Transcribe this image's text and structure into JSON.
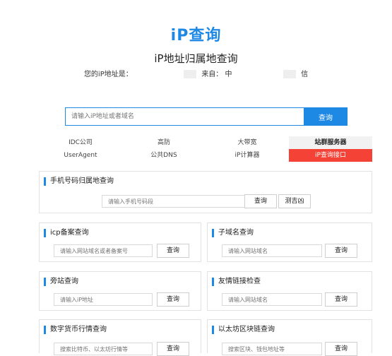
{
  "header": {
    "logo": "iP查询",
    "subtitle": "iP地址归属地查询",
    "ip_label": "您的iP地址是：",
    "from_label": "来自：",
    "from_prefix": "中",
    "from_suffix": "信"
  },
  "search": {
    "placeholder": "请输入iP地址或者域名",
    "button": "查询"
  },
  "nav": {
    "row1": [
      "IDC公司",
      "高防",
      "大带宽",
      "站群服务器"
    ],
    "row2": [
      "UserAgent",
      "公共DNS",
      "iP计算器",
      "iP查询接口"
    ]
  },
  "panels": {
    "phone": {
      "title": "手机号码归属地查询",
      "placeholder": "请输入手机号码段",
      "button": "查询",
      "button2": "测吉凶"
    },
    "icp": {
      "title": "icp备案查询",
      "placeholder": "请输入网站域名或者备案号",
      "button": "查询"
    },
    "subdomain": {
      "title": "子域名查询",
      "placeholder": "请输入网站域名",
      "button": "查询"
    },
    "sidesite": {
      "title": "旁站查询",
      "placeholder": "请输入iP地址",
      "button": "查询"
    },
    "friendlink": {
      "title": "友情链接检查",
      "placeholder": "请输入网站域名",
      "button": "查询"
    },
    "crypto": {
      "title": "数字货币行情查询",
      "placeholder": "搜索比特币、以太坊行情等",
      "button": "查询"
    },
    "eth": {
      "title": "以太坊区块链查询",
      "placeholder": "搜索区块、钱包地址等",
      "button": "查询"
    }
  },
  "colors": {
    "accent": "#1e88e5",
    "highlight": "#f44336"
  }
}
